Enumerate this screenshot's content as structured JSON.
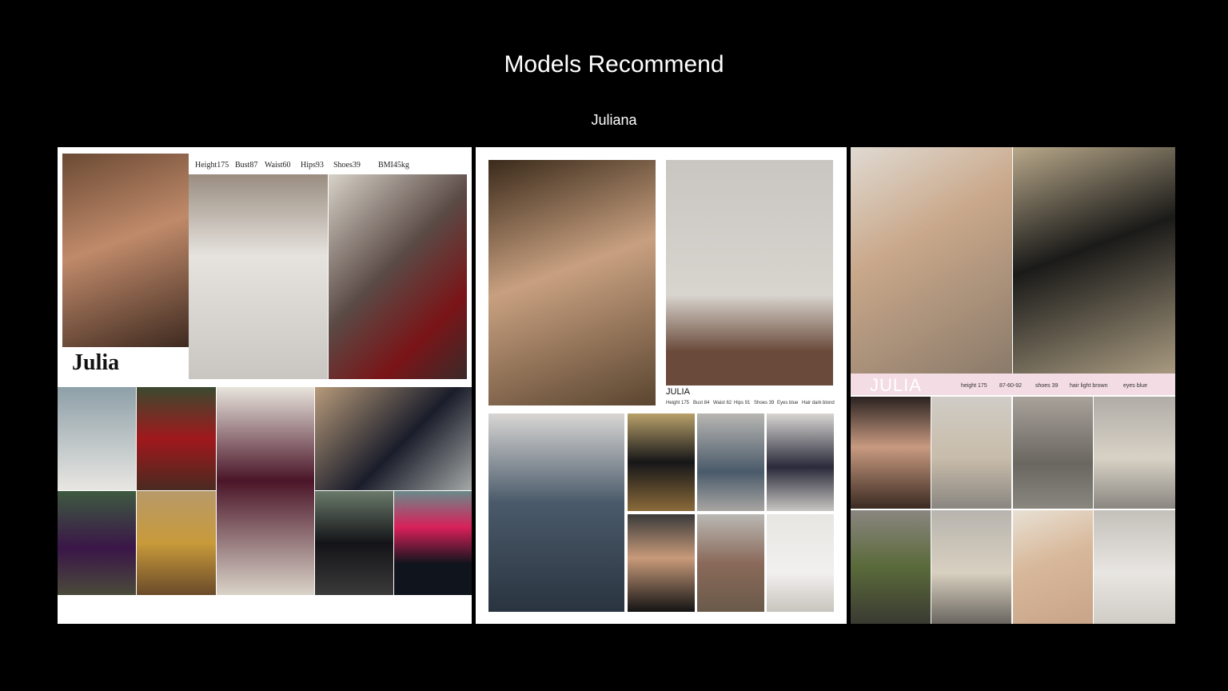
{
  "page": {
    "title": "Models Recommend",
    "subtitle": "Juliana"
  },
  "card1": {
    "name": "Julia",
    "stats": [
      "Height175",
      "Bust87",
      "Waist60",
      "Hips93",
      "Shoes39",
      "BMI45kg"
    ]
  },
  "card2": {
    "name": "JULIA",
    "stats": [
      "Height 175",
      "Bust 84",
      "Waist 62",
      "Hips 91",
      "Shoes 39",
      "Eyes blue",
      "Hair dark blond"
    ]
  },
  "card3": {
    "name": "JULIA",
    "stats": [
      "height 175",
      "87-60-92",
      "shoes 39",
      "hair light brown",
      "eyes blue"
    ]
  },
  "colors": {
    "background": "#000000",
    "text": "#ffffff",
    "card3_band": "#f3dce4"
  }
}
